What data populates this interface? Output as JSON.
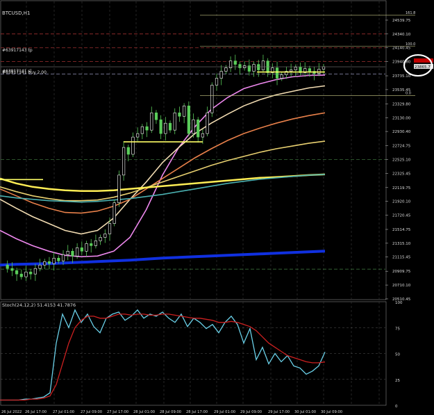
{
  "chart_data": [
    {
      "type": "candlestick",
      "title": "BTCUSD,H1  23780.81 23876.70 23778.81 23865.71",
      "symbol_label": "BTCUSD,H1",
      "ohlc_label": "23780.81 23876.70 23778.81 23865.71",
      "current_price": "23865.71",
      "y_tick_labels": [
        "24539.75",
        "24340.10",
        "24140.45",
        "23940.80",
        "23735.10",
        "23535.45",
        "23329.80",
        "23130.00",
        "22930.40",
        "22724.75",
        "22525.10",
        "22325.45",
        "22119.75",
        "21920.10",
        "21720.45",
        "21514.75",
        "21315.10",
        "21115.45",
        "20909.75",
        "20710.10",
        "20510.45"
      ],
      "ylim": [
        20510,
        24680
      ],
      "x_tick_labels": [
        "26 Jul 2022",
        "26 Jul 17:00",
        "27 Jul 01:00",
        "27 Jul 09:00",
        "27 Jul 17:00",
        "28 Jul 01:00",
        "28 Jul 09:00",
        "28 Jul 17:00",
        "29 Jul 01:00",
        "29 Jul 09:00",
        "29 Jul 17:00",
        "30 Jul 01:00",
        "30 Jul 09:00"
      ],
      "annotations": [
        "#63917143 tp",
        "#63917141 sl",
        "#63917141 buy 2.00",
        "161.8",
        "100.0",
        "0.0"
      ],
      "close_path": [
        21000,
        20950,
        20920,
        20870,
        20830,
        20900,
        20870,
        20950,
        21000,
        21050,
        21020,
        21100,
        21060,
        21150,
        21200,
        21130,
        21250,
        21200,
        21310,
        21280,
        21350,
        21400,
        21450,
        21600,
        21900,
        22300,
        22700,
        22600,
        22850,
        22900,
        23000,
        22950,
        23200,
        23100,
        22900,
        23050,
        22950,
        23200,
        23150,
        23300,
        22900,
        23100,
        22850,
        22900,
        23200,
        23600,
        23700,
        23800,
        23850,
        23950,
        23900,
        23850,
        23880,
        23800,
        23900,
        23820,
        23950,
        23780,
        23850,
        23700,
        23750,
        23800,
        23820,
        23860,
        23780,
        23840,
        23800,
        23770,
        23830,
        23865.71
      ],
      "series": [
        {
          "name": "",
          "color": "#ee88ee",
          "values": [
            21500,
            21380,
            21280,
            21200,
            21140,
            21120,
            21130,
            21200,
            21400,
            21800,
            22300,
            22700,
            23000,
            23250,
            23420,
            23550,
            23620,
            23680,
            23720,
            23740,
            23745
          ]
        },
        {
          "name": "",
          "color": "#f2dcb2",
          "values": [
            21950,
            21820,
            21700,
            21600,
            21500,
            21450,
            21500,
            21680,
            21950,
            22200,
            22480,
            22700,
            22900,
            23050,
            23180,
            23300,
            23390,
            23460,
            23510,
            23560,
            23590
          ]
        },
        {
          "name": "",
          "color": "#e8804a",
          "values": [
            22100,
            22000,
            21900,
            21820,
            21760,
            21750,
            21780,
            21850,
            21950,
            22100,
            22250,
            22400,
            22550,
            22680,
            22800,
            22900,
            22980,
            23050,
            23110,
            23160,
            23200
          ]
        },
        {
          "name": "",
          "color": "#e8d070",
          "values": [
            22130,
            22060,
            22000,
            21960,
            21930,
            21930,
            21940,
            21980,
            22040,
            22120,
            22200,
            22280,
            22360,
            22440,
            22510,
            22570,
            22630,
            22680,
            22720,
            22760,
            22790
          ]
        },
        {
          "name": "",
          "color": "#ffee55",
          "values": [
            22250,
            22180,
            22130,
            22100,
            22080,
            22070,
            22070,
            22080,
            22100,
            22120,
            22140,
            22160,
            22180,
            22200,
            22220,
            22240,
            22260,
            22270,
            22285,
            22300,
            22310
          ]
        },
        {
          "name": "",
          "color": "#4ab0b0",
          "values": [
            22000,
            21970,
            21950,
            21930,
            21920,
            21910,
            21920,
            21940,
            21960,
            21990,
            22020,
            22060,
            22100,
            22140,
            22180,
            22210,
            22240,
            22260,
            22280,
            22300,
            22310
          ]
        },
        {
          "name": "",
          "color": "#1030e0",
          "values": [
            21000,
            21010,
            21015,
            21020,
            21030,
            21040,
            21050,
            21060,
            21070,
            21085,
            21100,
            21110,
            21120,
            21130,
            21140,
            21150,
            21160,
            21170,
            21180,
            21190,
            21200
          ]
        }
      ]
    },
    {
      "type": "line",
      "title": "Stoch(24,12,2) 51.4153 41.7876",
      "y_tick_labels": [
        "100",
        "75",
        "50",
        "25",
        "0"
      ],
      "ylim": [
        0,
        100
      ],
      "series": [
        {
          "name": "",
          "color": "#6ad0e8",
          "values": [
            5,
            5,
            5,
            5,
            6,
            6,
            7,
            8,
            12,
            60,
            88,
            75,
            92,
            80,
            88,
            76,
            70,
            84,
            88,
            90,
            82,
            86,
            92,
            84,
            88,
            86,
            90,
            84,
            80,
            88,
            76,
            84,
            80,
            74,
            78,
            70,
            80,
            86,
            78,
            60,
            74,
            44,
            56,
            40,
            50,
            42,
            48,
            38,
            36,
            30,
            33,
            38,
            51.4153
          ]
        },
        {
          "name": "",
          "color": "#cc2020",
          "values": [
            5,
            5,
            5,
            5,
            5,
            6,
            6,
            7,
            9,
            20,
            40,
            60,
            75,
            82,
            86,
            86,
            84,
            84,
            86,
            88,
            88,
            87,
            88,
            88,
            87,
            87,
            88,
            88,
            87,
            86,
            85,
            84,
            84,
            83,
            82,
            80,
            80,
            81,
            80,
            78,
            76,
            72,
            66,
            60,
            56,
            52,
            48,
            46,
            44,
            42,
            41,
            41,
            41.7876
          ]
        }
      ]
    }
  ]
}
